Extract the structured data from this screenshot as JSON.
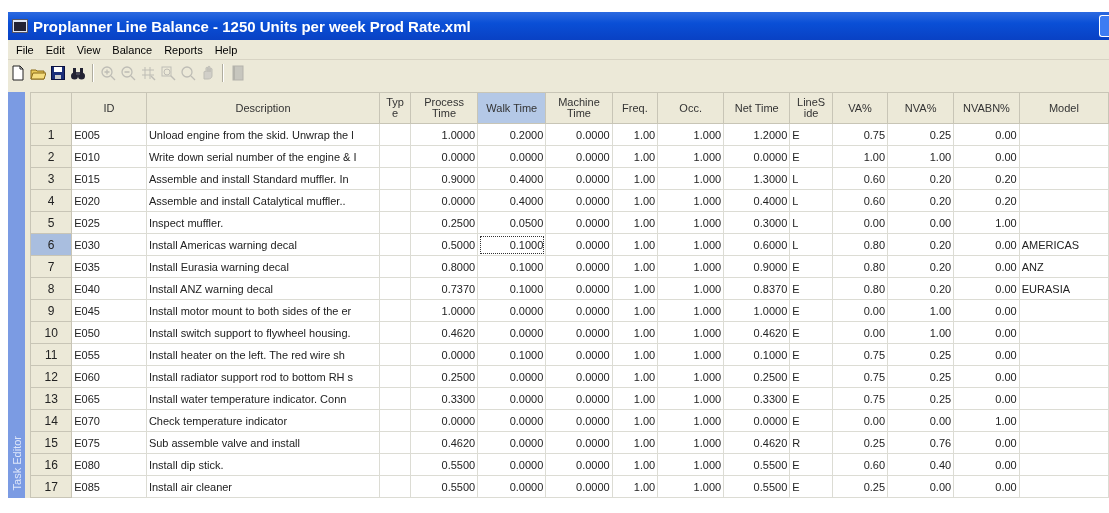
{
  "window": {
    "title": "Proplanner Line Balance - 1250 Units per week Prod Rate.xml"
  },
  "menu": [
    {
      "label": "File"
    },
    {
      "label": "Edit"
    },
    {
      "label": "View"
    },
    {
      "label": "Balance"
    },
    {
      "label": "Reports"
    },
    {
      "label": "Help"
    }
  ],
  "toolbar": [
    {
      "kind": "new",
      "disabled": false
    },
    {
      "kind": "open",
      "disabled": false
    },
    {
      "kind": "save",
      "disabled": false
    },
    {
      "kind": "find",
      "disabled": false
    },
    {
      "kind": "separator"
    },
    {
      "kind": "zoom-in",
      "disabled": true
    },
    {
      "kind": "zoom-out",
      "disabled": true
    },
    {
      "kind": "zoom-grid",
      "disabled": true
    },
    {
      "kind": "zoom-box",
      "disabled": true
    },
    {
      "kind": "zoom",
      "disabled": true
    },
    {
      "kind": "pan",
      "disabled": true
    },
    {
      "kind": "separator"
    },
    {
      "kind": "book",
      "disabled": true
    }
  ],
  "side_tab": {
    "label": "Task Editor"
  },
  "table": {
    "columns": [
      {
        "label": "ID",
        "selected": false
      },
      {
        "label": "Description",
        "selected": false
      },
      {
        "label": "Typ\ne",
        "selected": false
      },
      {
        "label": "Process\nTime",
        "selected": false
      },
      {
        "label": "Walk Time",
        "selected": true
      },
      {
        "label": "Machine\nTime",
        "selected": false
      },
      {
        "label": "Freq.",
        "selected": false
      },
      {
        "label": "Occ.",
        "selected": false
      },
      {
        "label": "Net Time",
        "selected": false
      },
      {
        "label": "LineS\nide",
        "selected": false
      },
      {
        "label": "VA%",
        "selected": false
      },
      {
        "label": "NVA%",
        "selected": false
      },
      {
        "label": "NVABN%",
        "selected": false
      },
      {
        "label": "Model",
        "selected": false
      }
    ],
    "rows": [
      {
        "row": "1",
        "selected": false,
        "id": "E005",
        "description": "Unload engine from the skid. Unwrap the l",
        "process_time": "1.0000",
        "walk_time": "0.2000",
        "machine_time": "0.0000",
        "freq": "1.00",
        "occ": "1.000",
        "net_time": "1.2000",
        "line_side": "E",
        "va": "0.75",
        "nva": "0.25",
        "nvabn": "0.00"
      },
      {
        "row": "2",
        "selected": false,
        "id": "E010",
        "description": "Write down serial number of the engine & I",
        "process_time": "0.0000",
        "walk_time": "0.0000",
        "machine_time": "0.0000",
        "freq": "1.00",
        "occ": "1.000",
        "net_time": "0.0000",
        "line_side": "E",
        "va": "1.00",
        "nva": "1.00",
        "nvabn": "0.00"
      },
      {
        "row": "3",
        "selected": false,
        "id": "E015",
        "description": "Assemble and install Standard muffler.  In",
        "process_time": "0.9000",
        "walk_time": "0.4000",
        "machine_time": "0.0000",
        "freq": "1.00",
        "occ": "1.000",
        "net_time": "1.3000",
        "line_side": "L",
        "va": "0.60",
        "nva": "0.20",
        "nvabn": "0.20"
      },
      {
        "row": "4",
        "selected": false,
        "id": "E020",
        "description": "Assemble and install Catalytical muffler..",
        "process_time": "0.0000",
        "walk_time": "0.4000",
        "machine_time": "0.0000",
        "freq": "1.00",
        "occ": "1.000",
        "net_time": "0.4000",
        "line_side": "L",
        "va": "0.60",
        "nva": "0.20",
        "nvabn": "0.20"
      },
      {
        "row": "5",
        "selected": false,
        "id": "E025",
        "description": "Inspect muffler.",
        "process_time": "0.2500",
        "walk_time": "0.0500",
        "machine_time": "0.0000",
        "freq": "1.00",
        "occ": "1.000",
        "net_time": "0.3000",
        "line_side": "L",
        "va": "0.00",
        "nva": "0.00",
        "nvabn": "1.00"
      },
      {
        "row": "6",
        "selected": true,
        "id": "E030",
        "description": "Install Americas warning decal",
        "process_time": "0.5000",
        "walk_time": "0.1000",
        "machine_time": "0.0000",
        "freq": "1.00",
        "occ": "1.000",
        "net_time": "0.6000",
        "line_side": "L",
        "va": "0.80",
        "nva": "0.20",
        "nvabn": "0.00",
        "model": "AMERICAS"
      },
      {
        "row": "7",
        "selected": false,
        "id": "E035",
        "description": "Install Eurasia warning decal",
        "process_time": "0.8000",
        "walk_time": "0.1000",
        "machine_time": "0.0000",
        "freq": "1.00",
        "occ": "1.000",
        "net_time": "0.9000",
        "line_side": "E",
        "va": "0.80",
        "nva": "0.20",
        "nvabn": "0.00",
        "model": "ANZ"
      },
      {
        "row": "8",
        "selected": false,
        "id": "E040",
        "description": "Install ANZ warning decal",
        "process_time": "0.7370",
        "walk_time": "0.1000",
        "machine_time": "0.0000",
        "freq": "1.00",
        "occ": "1.000",
        "net_time": "0.8370",
        "line_side": "E",
        "va": "0.80",
        "nva": "0.20",
        "nvabn": "0.00",
        "model": "EURASIA"
      },
      {
        "row": "9",
        "selected": false,
        "id": "E045",
        "description": "Install motor mount to both sides of the er",
        "process_time": "1.0000",
        "walk_time": "0.0000",
        "machine_time": "0.0000",
        "freq": "1.00",
        "occ": "1.000",
        "net_time": "1.0000",
        "line_side": "E",
        "va": "0.00",
        "nva": "1.00",
        "nvabn": "0.00"
      },
      {
        "row": "10",
        "selected": false,
        "id": "E050",
        "description": "Install switch support to flywheel housing.",
        "process_time": "0.4620",
        "walk_time": "0.0000",
        "machine_time": "0.0000",
        "freq": "1.00",
        "occ": "1.000",
        "net_time": "0.4620",
        "line_side": "E",
        "va": "0.00",
        "nva": "1.00",
        "nvabn": "0.00"
      },
      {
        "row": "11",
        "selected": false,
        "id": "E055",
        "description": "Install heater on the left. The red wire sh",
        "process_time": "0.0000",
        "walk_time": "0.1000",
        "machine_time": "0.0000",
        "freq": "1.00",
        "occ": "1.000",
        "net_time": "0.1000",
        "line_side": "E",
        "va": "0.75",
        "nva": "0.25",
        "nvabn": "0.00"
      },
      {
        "row": "12",
        "selected": false,
        "id": "E060",
        "description": "Install radiator support rod to bottom RH s",
        "process_time": "0.2500",
        "walk_time": "0.0000",
        "machine_time": "0.0000",
        "freq": "1.00",
        "occ": "1.000",
        "net_time": "0.2500",
        "line_side": "E",
        "va": "0.75",
        "nva": "0.25",
        "nvabn": "0.00"
      },
      {
        "row": "13",
        "selected": false,
        "id": "E065",
        "description": "Install water temperature indicator. Conn",
        "process_time": "0.3300",
        "walk_time": "0.0000",
        "machine_time": "0.0000",
        "freq": "1.00",
        "occ": "1.000",
        "net_time": "0.3300",
        "line_side": "E",
        "va": "0.75",
        "nva": "0.25",
        "nvabn": "0.00"
      },
      {
        "row": "14",
        "selected": false,
        "id": "E070",
        "description": "Check temperature indicator",
        "process_time": "0.0000",
        "walk_time": "0.0000",
        "machine_time": "0.0000",
        "freq": "1.00",
        "occ": "1.000",
        "net_time": "0.0000",
        "line_side": "E",
        "va": "0.00",
        "nva": "0.00",
        "nvabn": "1.00"
      },
      {
        "row": "15",
        "selected": false,
        "id": "E075",
        "description": "Sub assemble valve and install",
        "process_time": "0.4620",
        "walk_time": "0.0000",
        "machine_time": "0.0000",
        "freq": "1.00",
        "occ": "1.000",
        "net_time": "0.4620",
        "line_side": "R",
        "va": "0.25",
        "nva": "0.76",
        "nvabn": "0.00"
      },
      {
        "row": "16",
        "selected": false,
        "id": "E080",
        "description": "Install dip stick.",
        "process_time": "0.5500",
        "walk_time": "0.0000",
        "machine_time": "0.0000",
        "freq": "1.00",
        "occ": "1.000",
        "net_time": "0.5500",
        "line_side": "E",
        "va": "0.60",
        "nva": "0.40",
        "nvabn": "0.00"
      },
      {
        "row": "17",
        "selected": false,
        "id": "E085",
        "description": "Install air cleaner",
        "process_time": "0.5500",
        "walk_time": "0.0000",
        "machine_time": "0.0000",
        "freq": "1.00",
        "occ": "1.000",
        "net_time": "0.5500",
        "line_side": "E",
        "va": "0.25",
        "nva": "0.00",
        "nvabn": "0.00"
      }
    ]
  }
}
